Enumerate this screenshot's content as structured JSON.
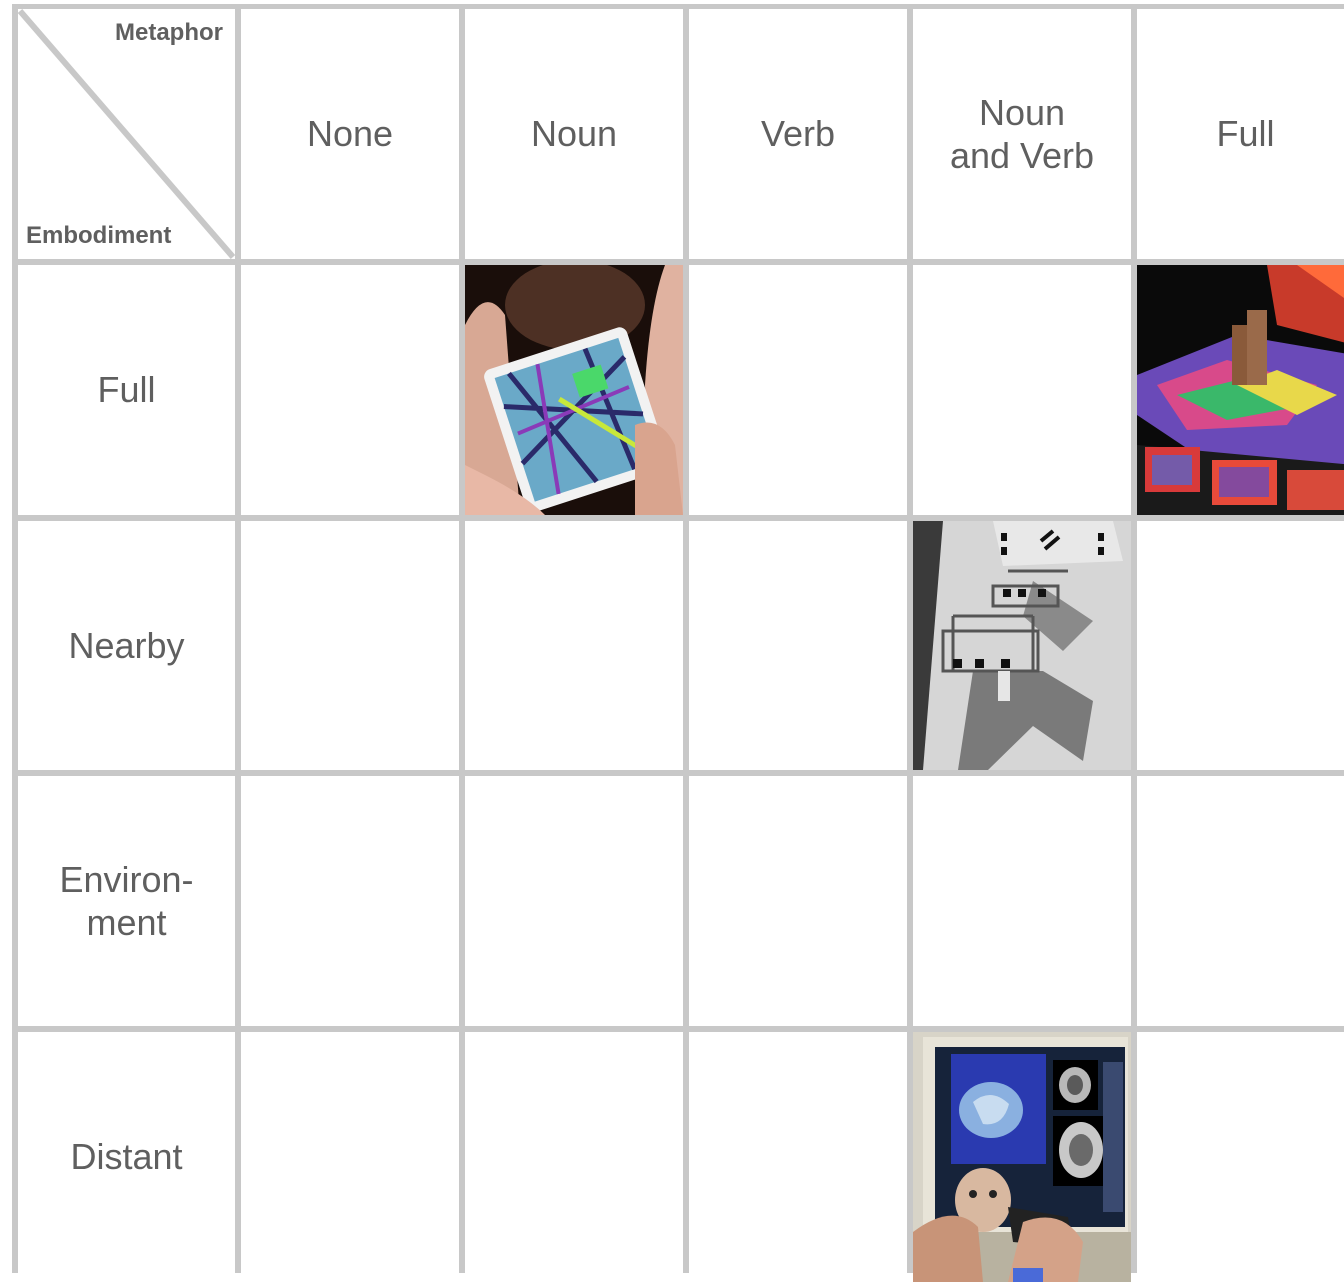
{
  "corner": {
    "top_label": "Metaphor",
    "bottom_label": "Embodiment"
  },
  "columns": [
    "None",
    "Noun",
    "Verb",
    "Noun\nand Verb",
    "Full"
  ],
  "rows": [
    "Full",
    "Nearby",
    "Environ-\nment",
    "Distant"
  ],
  "photos": {
    "full_noun": "photo-hands-holding-card-map",
    "full_full": "photo-colorful-terrain-visualization",
    "nearby_noun_and_verb": "photo-physical-model-with-shadows",
    "distant_noun_and_verb": "photo-doll-head-brain-scan-monitor"
  },
  "colors": {
    "grid_lines": "#c8c8c8",
    "text": "#5f5f5f",
    "background": "#ffffff"
  }
}
